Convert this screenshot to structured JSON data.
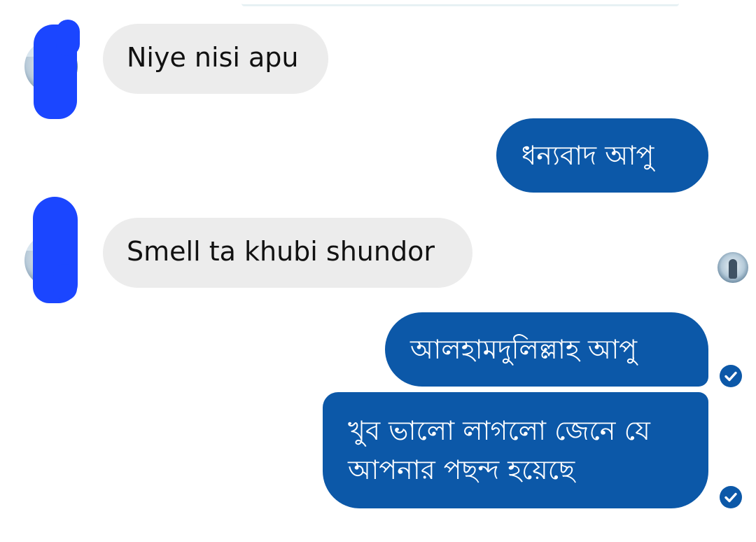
{
  "messages": [
    {
      "direction": "incoming",
      "text": "Niye nisi apu"
    },
    {
      "direction": "outgoing",
      "text": "ধন্যবাদ আপু"
    },
    {
      "direction": "incoming",
      "text": "Smell ta khubi shundor"
    },
    {
      "direction": "outgoing",
      "text": "আলহামদুলিল্লাহ আপু",
      "status": "check-icon"
    },
    {
      "direction": "outgoing",
      "lines": [
        "খুব ভালো লাগলো জেনে যে",
        "আপনার পছন্দ হয়েছে"
      ],
      "status": "check-icon"
    }
  ],
  "colors": {
    "incoming_bubble": "#ececec",
    "outgoing_bubble": "#0c58a8",
    "redaction": "#1b46ff"
  }
}
